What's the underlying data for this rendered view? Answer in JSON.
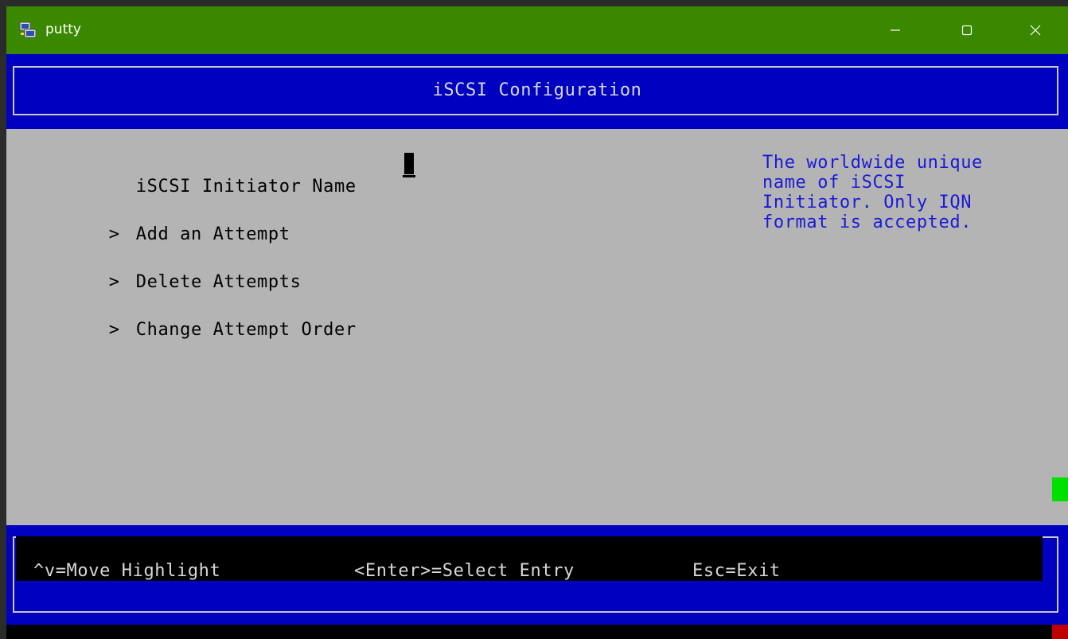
{
  "window": {
    "title": "putty",
    "icon": "putty-icon",
    "controls": [
      "minimize-icon",
      "maximize-icon",
      "close-icon"
    ],
    "titlebar_color": "#3a8700"
  },
  "screen": {
    "header_title": "iSCSI Configuration",
    "menu": [
      {
        "arrow": "",
        "label": "iSCSI Initiator Name"
      },
      {
        "arrow": ">",
        "label": "Add an Attempt"
      },
      {
        "arrow": ">",
        "label": "Delete Attempts"
      },
      {
        "arrow": ">",
        "label": "Change Attempt Order"
      }
    ],
    "initiator_name_value": "",
    "help_text": "The worldwide unique\nname of iSCSI\nInitiator. Only IQN\nformat is accepted.",
    "colors": {
      "header_bg": "#0000c0",
      "body_bg": "#b4b4b4",
      "help_text": "#1a1ad6"
    }
  },
  "footer": {
    "move_hint": "^v=Move Highlight",
    "enter_hint": "<Enter>=Select Entry",
    "esc_hint": "Esc=Exit"
  }
}
